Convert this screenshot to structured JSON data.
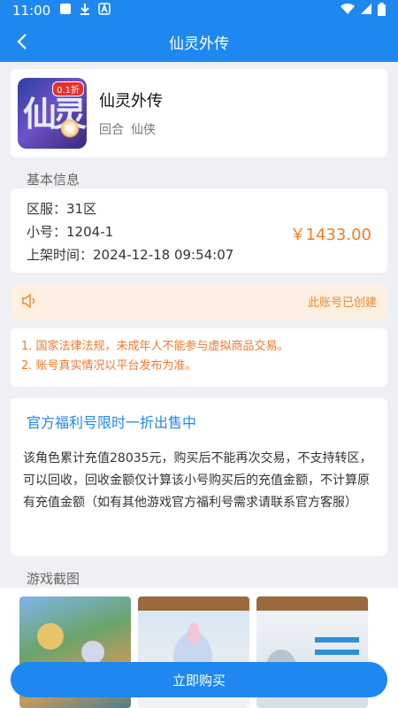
{
  "status_bar": {
    "time": "11:00"
  },
  "header": {
    "title": "仙灵外传"
  },
  "game": {
    "name": "仙灵外传",
    "tags": [
      "回合",
      "仙侠"
    ],
    "icon_badge": "0.1折"
  },
  "basic_info": {
    "section_title": "基本信息",
    "server_label": "区服：",
    "server_value": "31区",
    "account_label": "小号：",
    "account_value": "1204-1",
    "listed_label": "上架时间：",
    "listed_value": "2024-12-18 09:54:07",
    "price": "￥1433.00"
  },
  "notice": {
    "text": "此账号已创建"
  },
  "warnings": [
    "1. 国家法律法规，未成年人不能参与虚拟商品交易。",
    "2. 账号真实情况以平台发布为准。"
  ],
  "promo": {
    "title": "官方福利号限时一折出售中",
    "body": "该角色累计充值28035元，购买后不能再次交易，不支持转区，可以回收，回收金额仅计算该小号购买后的充值金额，不计算原有充值金额（如有其他游戏官方福利号需求请联系官方客服）"
  },
  "screenshots": {
    "section_title": "游戏截图"
  },
  "actions": {
    "buy_label": "立即购买"
  },
  "colors": {
    "brand": "#1e88f0",
    "price": "#f47a20",
    "warning": "#f0792b"
  }
}
